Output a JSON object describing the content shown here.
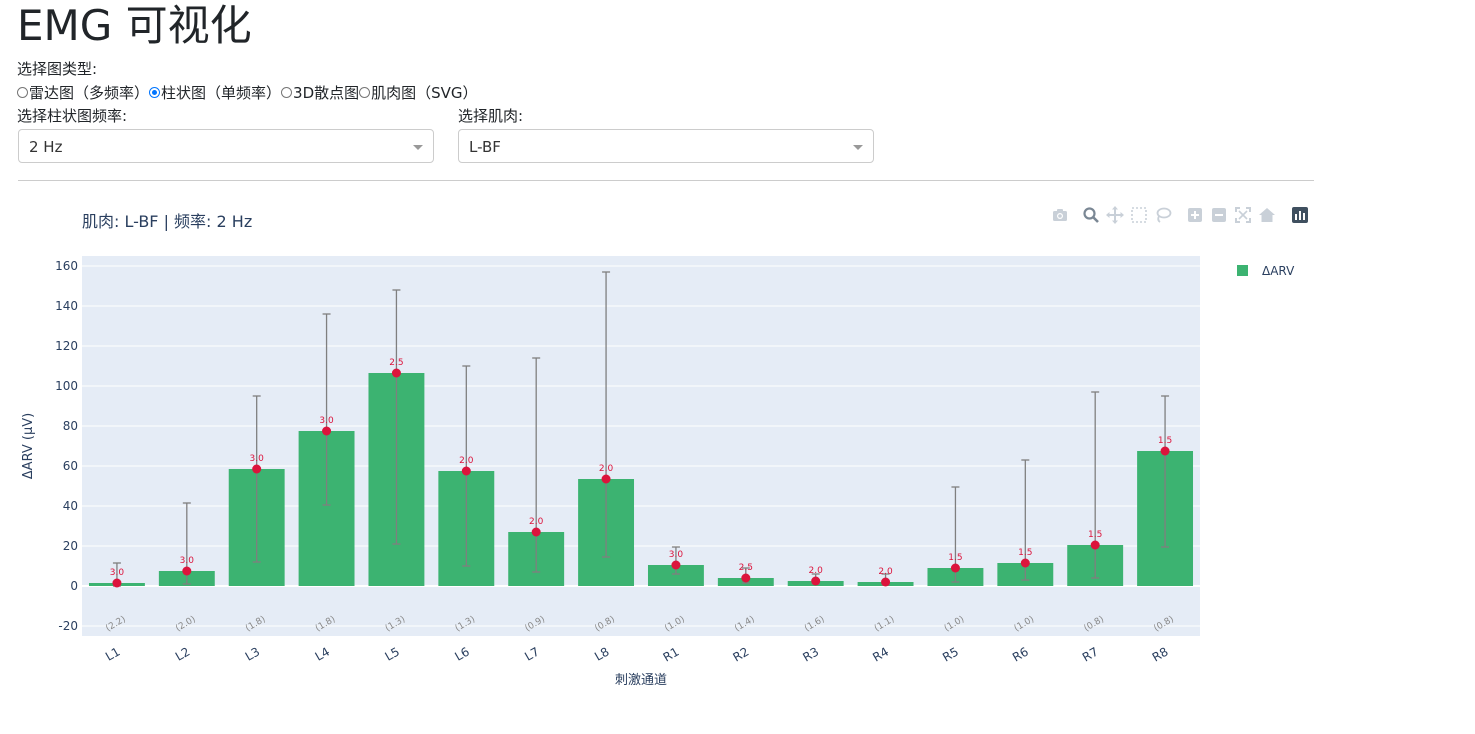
{
  "app": {
    "title": "EMG 可视化"
  },
  "controls": {
    "chart_type_label": "选择图类型:",
    "chart_type_options": [
      {
        "label": "雷达图（多频率）",
        "checked": false
      },
      {
        "label": "柱状图（单频率）",
        "checked": true
      },
      {
        "label": "3D散点图",
        "checked": false
      },
      {
        "label": "肌肉图（SVG）",
        "checked": false
      }
    ],
    "frequency_label": "选择柱状图频率:",
    "frequency_value": "2 Hz",
    "muscle_label": "选择肌肉:",
    "muscle_value": "L-BF"
  },
  "modebar": {
    "icons": [
      "camera-icon",
      "zoom-icon",
      "pan-icon",
      "box-select-icon",
      "lasso-icon",
      "zoom-in-icon",
      "zoom-out-icon",
      "autoscale-icon",
      "reset-axes-icon",
      "plotly-logo-icon"
    ]
  },
  "colors": {
    "bar": "#3cb371",
    "marker": "#dc143c",
    "plot_bg": "#e5ecf6",
    "error_bar": "#7f7f7f",
    "text": "#2a3f5f"
  },
  "chart_data": {
    "type": "bar",
    "title": "肌肉: L-BF | 频率: 2 Hz",
    "xlabel": "刺激通道",
    "ylabel": "ΔARV (μV)",
    "ylim": [
      -25,
      165
    ],
    "yticks": [
      -20,
      0,
      20,
      40,
      60,
      80,
      100,
      120,
      140,
      160
    ],
    "grid": true,
    "legend": {
      "position": "top-right",
      "entries": [
        "ΔARV"
      ]
    },
    "categories": [
      "L1",
      "L2",
      "L3",
      "L4",
      "L5",
      "L6",
      "L7",
      "L8",
      "R1",
      "R2",
      "R3",
      "R4",
      "R5",
      "R6",
      "R7",
      "R8"
    ],
    "series": [
      {
        "name": "ΔARV",
        "values": [
          1.5,
          7.5,
          58.5,
          77.5,
          106.5,
          57.5,
          27,
          53.5,
          10.5,
          4,
          2.5,
          2,
          9,
          11.5,
          20.5,
          67.5
        ],
        "error_upper": [
          11.5,
          41.5,
          95,
          136,
          148,
          110,
          114,
          157,
          19.5,
          9,
          6,
          6,
          49.5,
          63,
          97,
          95
        ],
        "error_lower": [
          0,
          1,
          12,
          40.5,
          21,
          10,
          7,
          14.5,
          6,
          1.5,
          1,
          0.5,
          2,
          3,
          4,
          19.5
        ]
      }
    ],
    "marker_labels": [
      "3.0",
      "3.0",
      "3.0",
      "3.0",
      "2.5",
      "2.0",
      "2.0",
      "2.0",
      "3.0",
      "2.5",
      "2.0",
      "2.0",
      "1.5",
      "1.5",
      "1.5",
      "1.5"
    ],
    "bottom_labels": [
      "(2.2)",
      "(2.0)",
      "(1.8)",
      "(1.8)",
      "(1.3)",
      "(1.3)",
      "(0.9)",
      "(0.8)",
      "(1.0)",
      "(1.4)",
      "(1.6)",
      "(1.1)",
      "(1.0)",
      "(1.0)",
      "(0.8)",
      "(0.8)"
    ]
  }
}
